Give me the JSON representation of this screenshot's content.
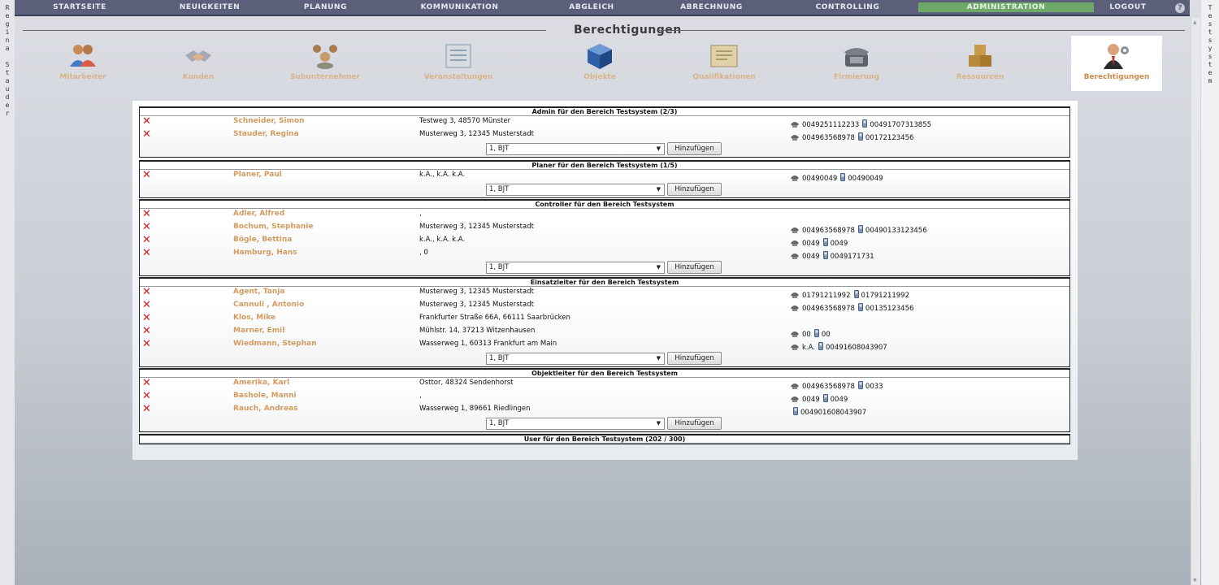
{
  "user": {
    "vertical_name": "Regina Stauder"
  },
  "system": {
    "vertical_name": "Testsystem"
  },
  "nav": {
    "items": [
      "STARTSEITE",
      "NEUIGKEITEN",
      "PLANUNG",
      "KOMMUNIKATION",
      "ABGLEICH",
      "ABRECHNUNG",
      "CONTROLLING",
      "ADMINISTRATION",
      "LOGOUT"
    ],
    "active": "ADMINISTRATION",
    "active_color": "#6ea96a"
  },
  "page": {
    "title": "Berechtigungen"
  },
  "modules": [
    {
      "label": "Mitarbeiter",
      "icon": "people-icon"
    },
    {
      "label": "Kunden",
      "icon": "handshake-icon"
    },
    {
      "label": "Subunternehmer",
      "icon": "contractors-icon"
    },
    {
      "label": "Veranstaltungen",
      "icon": "event-plan-icon"
    },
    {
      "label": "Objekte",
      "icon": "cube-icon"
    },
    {
      "label": "Qualifikationen",
      "icon": "certificate-icon"
    },
    {
      "label": "Firmierung",
      "icon": "telephone-icon"
    },
    {
      "label": "Ressourcen",
      "icon": "boxes-icon"
    },
    {
      "label": "Berechtigungen",
      "icon": "admin-user-icon",
      "active": true
    }
  ],
  "sections": [
    {
      "title": "Admin für den Bereich Testsystem (2/3)",
      "members": [
        {
          "name": "Schneider, Simon",
          "address": "Testweg 3, 48570 Münster",
          "phone": "0049251112233",
          "mobile": "00491707313855"
        },
        {
          "name": "Stauder, Regina",
          "address": "Musterweg 3, 12345 Musterstadt",
          "phone": "004963568978",
          "mobile": "00172123456"
        }
      ],
      "select_value": "1, BJT",
      "add_label": "Hinzufügen"
    },
    {
      "title": "Planer für den Bereich Testsystem (1/5)",
      "members": [
        {
          "name": "Planer, Paul",
          "address": "k.A., k.A. k.A.",
          "phone": "00490049",
          "mobile": "00490049"
        }
      ],
      "select_value": "1, BJT",
      "add_label": "Hinzufügen"
    },
    {
      "title": "Controller für den Bereich Testsystem",
      "members": [
        {
          "name": "Adler, Alfred",
          "address": ","
        },
        {
          "name": "Bochum, Stephanie",
          "address": "Musterweg 3, 12345 Musterstadt",
          "phone": "004963568978",
          "mobile": "00490133123456"
        },
        {
          "name": "Bögle, Bettina",
          "address": "k.A., k.A. k.A.",
          "phone": "0049",
          "mobile": "0049"
        },
        {
          "name": "Hamburg, Hans",
          "address": ", 0",
          "phone": "0049",
          "mobile": "0049171731"
        }
      ],
      "select_value": "1, BJT",
      "add_label": "Hinzufügen"
    },
    {
      "title": "Einsatzleiter für den Bereich Testsystem",
      "members": [
        {
          "name": "Agent, Tanja",
          "address": "Musterweg 3, 12345 Musterstadt",
          "phone": "01791211992",
          "mobile": "01791211992"
        },
        {
          "name": "Cannuli , Antonio",
          "address": "Musterweg 3, 12345 Musterstadt",
          "phone": "004963568978",
          "mobile": "00135123456"
        },
        {
          "name": "Klos, Mike",
          "address": "Frankfurter Straße 66A, 66111 Saarbrücken"
        },
        {
          "name": "Marner, Emil",
          "address": "Mühlstr. 14, 37213 Witzenhausen",
          "phone": "00",
          "mobile": "00"
        },
        {
          "name": "Wiedmann, Stephan",
          "address": "Wasserweg 1, 60313 Frankfurt am Main",
          "phone": "k.A.",
          "mobile": "00491608043907"
        }
      ],
      "select_value": "1, BJT",
      "add_label": "Hinzufügen"
    },
    {
      "title": "Objektleiter für den Bereich Testsystem",
      "members": [
        {
          "name": "Amerika, Karl",
          "address": "Osttor, 48324 Sendenhorst",
          "phone": "004963568978",
          "mobile": "0033"
        },
        {
          "name": "Bashole, Manni",
          "address": ",",
          "phone": "0049",
          "mobile": "0049"
        },
        {
          "name": "Rauch, Andreas",
          "address": "Wasserweg 1, 89661 Riedlingen",
          "mobile": "004901608043907"
        }
      ],
      "select_value": "1, BJT",
      "add_label": "Hinzufügen"
    },
    {
      "title": "User für den Bereich Testsystem (202 / 300)",
      "members": []
    }
  ]
}
